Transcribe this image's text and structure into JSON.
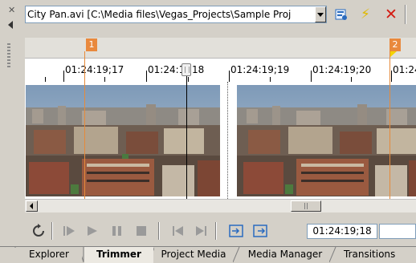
{
  "toolbar": {
    "media_file": "City Pan.avi   [C:\\Media files\\Vegas_Projects\\Sample Proj",
    "icons": [
      "media-properties-icon",
      "lightning-icon",
      "close-icon"
    ]
  },
  "markers": [
    {
      "label": "1"
    },
    {
      "label": "2"
    }
  ],
  "ruler": {
    "ticks": [
      "01:24:19;17",
      "01:24:1",
      "18",
      "01:24:19;19",
      "01:24:19;20",
      "01:24"
    ]
  },
  "transport": {
    "icons": [
      "loop-icon",
      "play-from-start-icon",
      "play-icon",
      "pause-icon",
      "stop-icon",
      "previous-frame-icon",
      "next-frame-icon",
      "add-to-timeline-start-icon",
      "add-to-timeline-end-icon"
    ],
    "timecode": "01:24:19;18",
    "timecode_secondary": ""
  },
  "tabs": [
    {
      "label": "Explorer",
      "active": false
    },
    {
      "label": "Trimmer",
      "active": true
    },
    {
      "label": "Project Media",
      "active": false
    },
    {
      "label": "Media Manager",
      "active": false
    },
    {
      "label": "Transitions",
      "active": false
    }
  ],
  "colors": {
    "marker": "#e9893d",
    "marker_line": "#e68a3a",
    "accent_blue": "#2a6bbf",
    "close_red": "#d41b12"
  }
}
